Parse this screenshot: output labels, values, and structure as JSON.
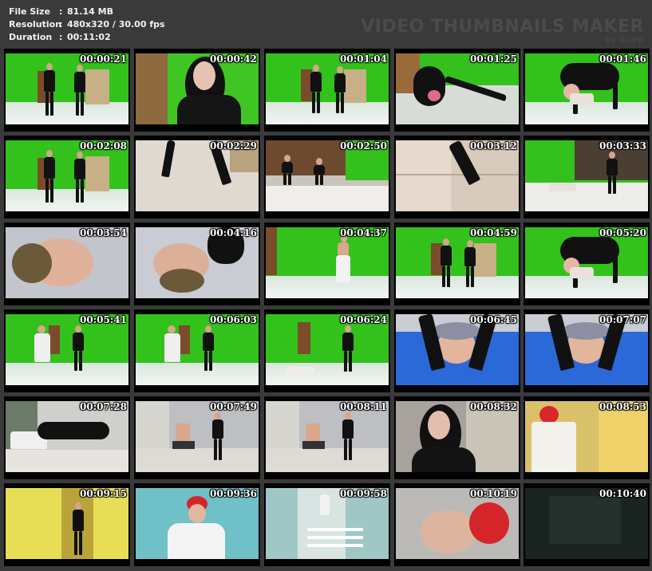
{
  "info": {
    "file_size_label": "File Size",
    "file_size": "81.14 MB",
    "resolution_label": "Resolution",
    "resolution": "480x320 / 30.00 fps",
    "duration_label": "Duration",
    "duration": "00:11:02"
  },
  "watermark": {
    "title": "VIDEO THUMBNAILS MAKER",
    "subtitle": "by Scorp"
  },
  "thumbnails": [
    {
      "time": "00:00:21",
      "scene": "green-two"
    },
    {
      "time": "00:00:42",
      "scene": "portrait-girl"
    },
    {
      "time": "00:01:04",
      "scene": "green-two-small"
    },
    {
      "time": "00:01:25",
      "scene": "split-floor"
    },
    {
      "time": "00:01:46",
      "scene": "wrestle-green"
    },
    {
      "time": "00:02:08",
      "scene": "green-two"
    },
    {
      "time": "00:02:29",
      "scene": "legs-floor"
    },
    {
      "time": "00:02:50",
      "scene": "green-wide"
    },
    {
      "time": "00:03:12",
      "scene": "tile-foot"
    },
    {
      "time": "00:03:33",
      "scene": "green-dark"
    },
    {
      "time": "00:03:54",
      "scene": "face-cap"
    },
    {
      "time": "00:04:16",
      "scene": "face-legs"
    },
    {
      "time": "00:04:37",
      "scene": "green-one-white"
    },
    {
      "time": "00:04:59",
      "scene": "green-two-small"
    },
    {
      "time": "00:05:20",
      "scene": "wrestle-green"
    },
    {
      "time": "00:05:41",
      "scene": "green-fight"
    },
    {
      "time": "00:06:03",
      "scene": "green-fight"
    },
    {
      "time": "00:06:24",
      "scene": "green-lying"
    },
    {
      "time": "00:06:45",
      "scene": "blue-mat-face"
    },
    {
      "time": "00:07:07",
      "scene": "blue-mat-face"
    },
    {
      "time": "00:07:28",
      "scene": "room-grapple"
    },
    {
      "time": "00:07:49",
      "scene": "room-chair"
    },
    {
      "time": "00:08:11",
      "scene": "room-chair"
    },
    {
      "time": "00:08:32",
      "scene": "portrait-girl-room"
    },
    {
      "time": "00:08:53",
      "scene": "hall-red"
    },
    {
      "time": "00:09:15",
      "scene": "hall-yellow"
    },
    {
      "time": "00:09:36",
      "scene": "red-cap-pose"
    },
    {
      "time": "00:09:58",
      "scene": "stairs"
    },
    {
      "time": "00:10:19",
      "scene": "face-red-cap"
    },
    {
      "time": "00:10:40",
      "scene": "dark"
    }
  ]
}
